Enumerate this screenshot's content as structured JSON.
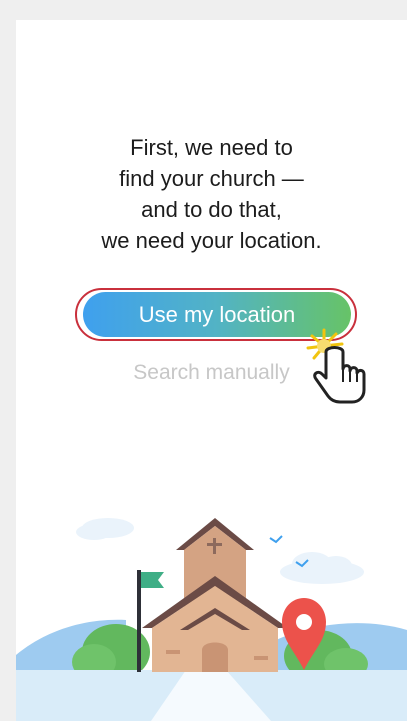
{
  "onboarding": {
    "headline_lines": [
      "First, we need to",
      "find your church —",
      "and to do that,",
      "we need your location."
    ],
    "primary_button_label": "Use my location",
    "secondary_link_label": "Search manually"
  },
  "colors": {
    "headline": "#1c1c1c",
    "button_gradient_start": "#3fa0ee",
    "button_gradient_end": "#67c367",
    "highlight_outline": "#c9303c",
    "secondary_link": "#c7c7c7",
    "location_pin": "#ec524b"
  },
  "icons": {
    "cursor": "pointing-hand-cursor-icon",
    "pin": "location-pin-icon",
    "flag": "flag-icon"
  }
}
